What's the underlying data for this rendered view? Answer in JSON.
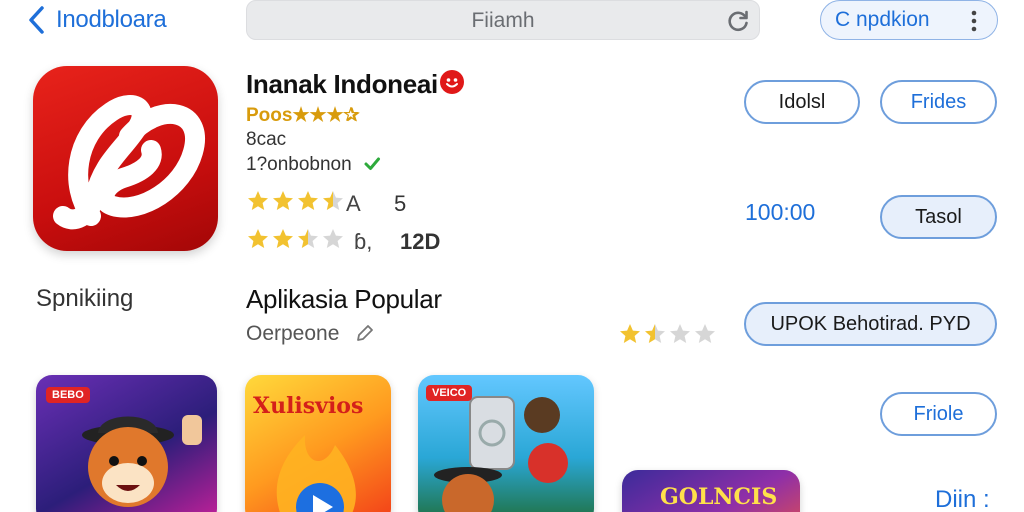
{
  "nav": {
    "back_label": "Inodbloara",
    "search_placeholder": "Fiiamh",
    "top_button_label": "C npdkion"
  },
  "app": {
    "title": "Inanak Indoneai",
    "positive_label": "Poos★★★✰",
    "size": "8cac",
    "developer": "1?onbobnon",
    "rating1_value": "A",
    "rating1_count": "5",
    "rating1_stars": 3.5,
    "rating2_value": "ɓ,",
    "rating2_count": "12D",
    "rating2_stars": 2.5
  },
  "buttons": {
    "btn_a": "Idolsl",
    "btn_b": "Frides",
    "time": "100:00",
    "btn_c": "Tasol",
    "btn_d": "UPOK Behotirad. PYD",
    "btn_e": "Friole"
  },
  "section": {
    "side_label": "Spnikiing",
    "title": "Aplikasia Popular",
    "subtitle": "Oerpeone",
    "rating_stars": 1.5
  },
  "thumbs": {
    "thumb1_tag": "BEBO",
    "thumb2_title": "Xulisvios",
    "thumb3_tag": "VEICO",
    "thumb4_title": "GOLNCIS"
  },
  "bottom_text": "Diin :",
  "colors": {
    "accent_blue": "#1e6fd9",
    "star_gold": "#f2c230",
    "app_red": "#d8141a",
    "verified_green": "#2eaa3c"
  },
  "icons": {
    "back": "chevron-left-icon",
    "refresh": "refresh-icon",
    "more": "more-vertical-icon",
    "verified": "check-badge-icon",
    "edit": "pencil-icon"
  }
}
